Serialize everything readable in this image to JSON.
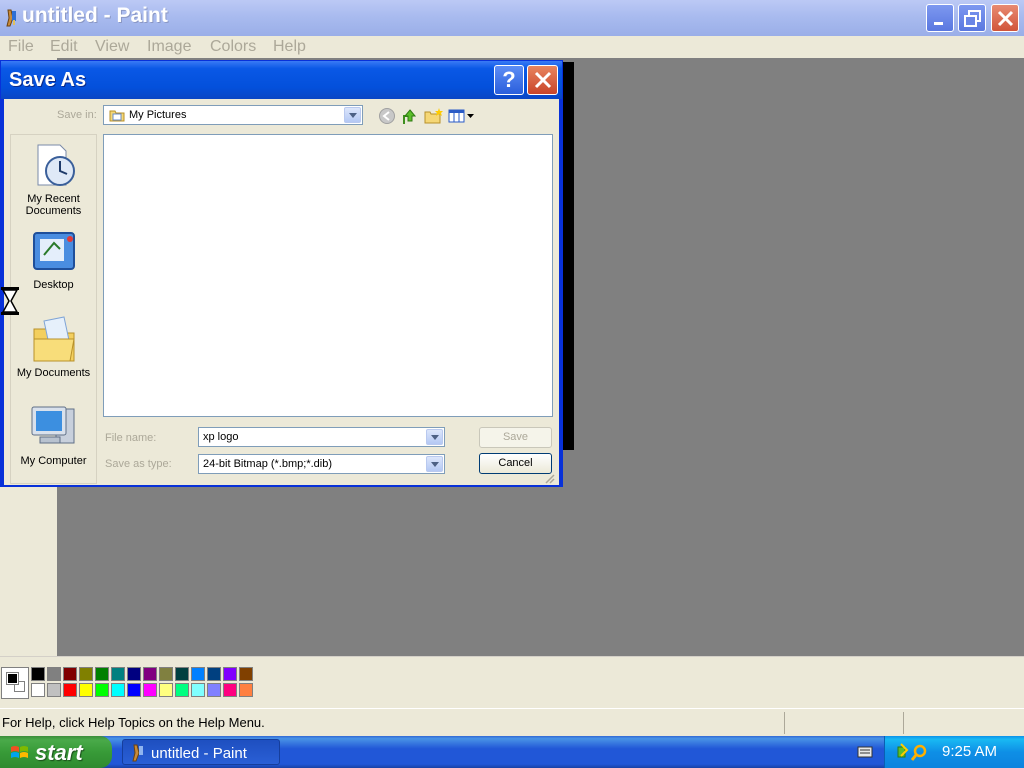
{
  "window": {
    "title": "untitled - Paint",
    "menus": [
      "File",
      "Edit",
      "View",
      "Image",
      "Colors",
      "Help"
    ]
  },
  "dialog": {
    "title": "Save As",
    "help_glyph": "?",
    "save_in_label": "Save in:",
    "save_in_value": "My Pictures",
    "places": [
      "My Recent Documents",
      "Desktop",
      "My Documents",
      "My Computer"
    ],
    "file_name_label": "File name:",
    "file_name_value": "xp logo",
    "save_as_type_label": "Save as type:",
    "save_as_type_value": "24-bit Bitmap (*.bmp;*.dib)",
    "save_button": "Save",
    "cancel_button": "Cancel"
  },
  "palette": {
    "foreground": "#000000",
    "background": "#ffffff",
    "colors_top": [
      "#000000",
      "#808080",
      "#800000",
      "#808000",
      "#008000",
      "#008080",
      "#000080",
      "#800080",
      "#808040",
      "#004040",
      "#0080ff",
      "#004080",
      "#8000ff",
      "#804000"
    ],
    "colors_bottom": [
      "#ffffff",
      "#c0c0c0",
      "#ff0000",
      "#ffff00",
      "#00ff00",
      "#00ffff",
      "#0000ff",
      "#ff00ff",
      "#ffff80",
      "#00ff80",
      "#80ffff",
      "#8080ff",
      "#ff0080",
      "#ff8040"
    ]
  },
  "status": {
    "help_text": "For Help, click Help Topics on the Help Menu."
  },
  "taskbar": {
    "start_label": "start",
    "task_label": "untitled - Paint",
    "clock": "9:25 AM"
  }
}
